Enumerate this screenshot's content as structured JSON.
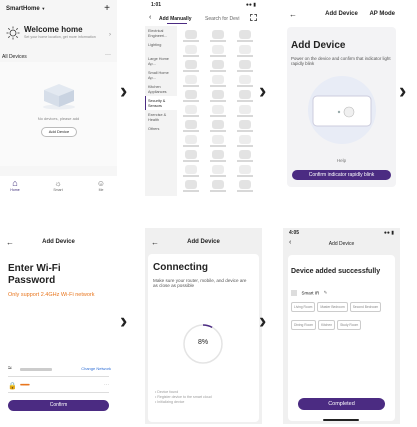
{
  "screen1": {
    "app_title": "SmartHome",
    "plus": "+",
    "welcome_title": "Welcome home",
    "welcome_sub": "Set your home location, get more information",
    "all_devices": "All Devices",
    "more": "···",
    "no_devices": "No devices, please add",
    "add_device_btn": "Add Device",
    "nav": [
      {
        "label": "Home"
      },
      {
        "label": "Smart"
      },
      {
        "label": "Me"
      }
    ]
  },
  "screen2": {
    "time": "1:01",
    "tab_manual": "Add Manually",
    "tab_search": "Search for Devi",
    "categories": [
      "Electrical Engineeri...",
      "Lighting",
      "Large Home Ap...",
      "Small Home Ap...",
      "Kitchen Appliances",
      "Security & Sensors",
      "Exercise & Health",
      "Others"
    ],
    "active_index": 5
  },
  "screen3": {
    "title": "Add Device",
    "ap_mode": "AP Mode",
    "heading": "Add Device",
    "desc": "Power on the device and confirm that indicator light rapidly blink",
    "help": "Help",
    "confirm_btn": "Confirm indicator rapidly blink"
  },
  "screen4": {
    "title": "Add Device",
    "heading": "Enter Wi-Fi Password",
    "note": "Only support 2.4GHz Wi-Fi network",
    "change_network": "Change Network",
    "password_value": "••••••••",
    "confirm_btn": "Confirm"
  },
  "screen5": {
    "title": "Add Device",
    "heading": "Connecting",
    "desc": "Make sure your router, mobile, and device are as close as possible",
    "percent": "8%",
    "progress": 0.08,
    "steps": [
      "Device found",
      "Register device to the smart cloud",
      "Initializing device"
    ]
  },
  "screen6": {
    "time": "4:05",
    "title": "Add Device",
    "heading": "Device added successfully",
    "device_name": "Smart IR",
    "rooms": [
      "Living Room",
      "Master Bedroom",
      "Second Bedroom",
      "Dining Room",
      "Kitchen",
      "Study Room"
    ],
    "completed_btn": "Completed"
  },
  "colors": {
    "accent": "#4b2b82",
    "warning": "#e8761e",
    "link": "#2f6fd6"
  }
}
